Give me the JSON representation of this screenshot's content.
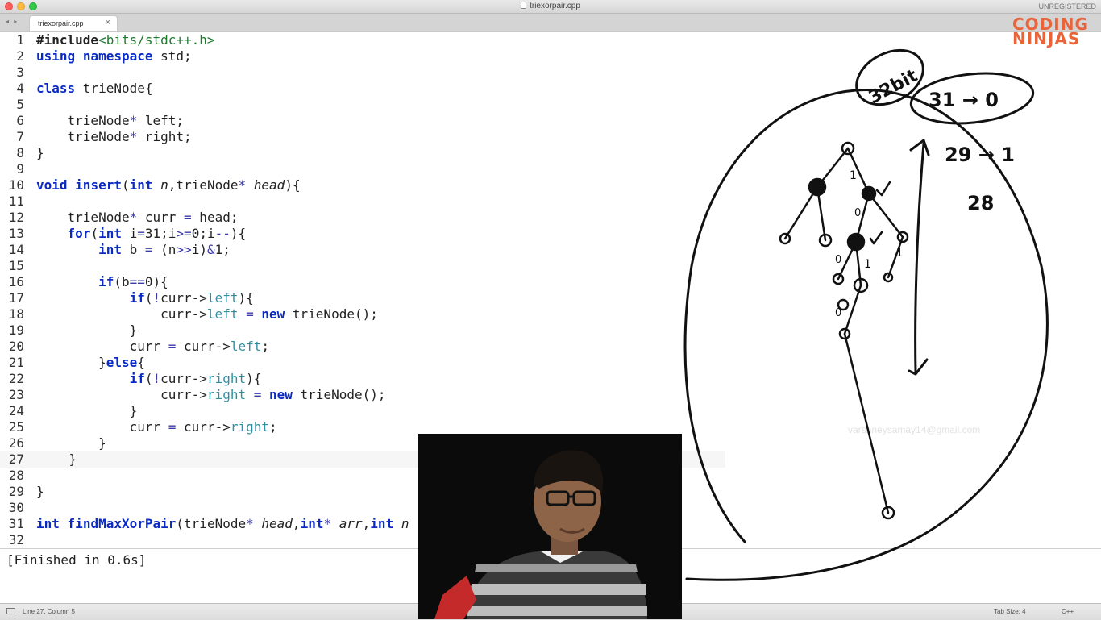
{
  "window": {
    "title": "triexorpair.cpp",
    "unregistered": "UNREGISTERED",
    "tab_nav": "◂ ▸",
    "tab": {
      "label": "triexorpair.cpp",
      "close": "×"
    }
  },
  "editor": {
    "lines": [
      {
        "n": "1"
      },
      {
        "n": "2"
      },
      {
        "n": "3"
      },
      {
        "n": "4"
      },
      {
        "n": "5"
      },
      {
        "n": "6"
      },
      {
        "n": "7"
      },
      {
        "n": "8"
      },
      {
        "n": "9"
      },
      {
        "n": "10"
      },
      {
        "n": "11"
      },
      {
        "n": "12"
      },
      {
        "n": "13"
      },
      {
        "n": "14"
      },
      {
        "n": "15"
      },
      {
        "n": "16"
      },
      {
        "n": "17"
      },
      {
        "n": "18"
      },
      {
        "n": "19"
      },
      {
        "n": "20"
      },
      {
        "n": "21"
      },
      {
        "n": "22"
      },
      {
        "n": "23"
      },
      {
        "n": "24"
      },
      {
        "n": "25"
      },
      {
        "n": "26"
      },
      {
        "n": "27"
      },
      {
        "n": "28"
      },
      {
        "n": "29"
      },
      {
        "n": "30"
      },
      {
        "n": "31"
      },
      {
        "n": "32"
      }
    ],
    "tokens": {
      "l1_pre": "#include",
      "l1_inc": "<bits/stdc++.h>",
      "l2_kw1": "using",
      "l2_kw2": "namespace",
      "l2_rest": " std;",
      "l4_kw": "class",
      "l4_rest": " trieNode{",
      "l6_a": "    trieNode",
      "l6_star": "*",
      "l6_b": " left;",
      "l7_a": "    trieNode",
      "l7_star": "*",
      "l7_b": " right;",
      "l8": "}",
      "l10_void": "void",
      "l10_fn": "insert",
      "l10_a": "(",
      "l10_int": "int",
      "l10_n": "n",
      "l10_b": ",trieNode",
      "l10_star": "*",
      "l10_head": "head",
      "l10_c": "){",
      "l12_a": "    trieNode",
      "l12_star": "*",
      "l12_b": " curr ",
      "l12_eq": "=",
      "l12_c": " head;",
      "l13_for": "for",
      "l13_a": "(",
      "l13_int": "int",
      "l13_b": " i",
      "l13_eq": "=",
      "l13_c": "31;i",
      "l13_ge": ">=",
      "l13_d": "0;i",
      "l13_dec": "--",
      "l13_e": "){",
      "l14_int": "int",
      "l14_a": " b ",
      "l14_eq": "=",
      "l14_b": " (n",
      "l14_sh": ">>",
      "l14_c": "i)",
      "l14_and": "&",
      "l14_d": "1;",
      "l16_if": "if",
      "l16_a": "(b",
      "l16_eq": "==",
      "l16_b": "0){",
      "l17_if": "if",
      "l17_a": "(",
      "l17_not": "!",
      "l17_b": "curr->",
      "l17_mem": "left",
      "l17_c": "){",
      "l18_a": "curr->",
      "l18_mem": "left",
      "l18_eq": " = ",
      "l18_new": "new",
      "l18_b": " trieNode();",
      "l19": "}",
      "l20_a": "curr ",
      "l20_eq": "=",
      "l20_b": " curr->",
      "l20_mem": "left",
      "l20_c": ";",
      "l21_a": "}",
      "l21_else": "else",
      "l21_b": "{",
      "l22_if": "if",
      "l22_a": "(",
      "l22_not": "!",
      "l22_b": "curr->",
      "l22_mem": "right",
      "l22_c": "){",
      "l23_a": "curr->",
      "l23_mem": "right",
      "l23_eq": " = ",
      "l23_new": "new",
      "l23_b": " trieNode();",
      "l24": "}",
      "l25_a": "curr ",
      "l25_eq": "=",
      "l25_b": " curr->",
      "l25_mem": "right",
      "l25_c": ";",
      "l26": "}",
      "l27": "}",
      "l29": "}",
      "l31_int": "int",
      "l31_fn": "findMaxXorPair",
      "l31_a": "(trieNode",
      "l31_star": "*",
      "l31_head": "head",
      "l31_b": ",",
      "l31_int2": "int",
      "l31_star2": "*",
      "l31_arr": "arr",
      "l31_c": ",",
      "l31_int3": "int",
      "l31_n": "n"
    }
  },
  "output": {
    "text": "[Finished in 0.6s]"
  },
  "status": {
    "position": "Line 27, Column 5",
    "tab_size": "Tab Size: 4",
    "language": "C++"
  },
  "sketch": {
    "label_bits": "32bit",
    "label_31": "31 → 0",
    "label_29": "29 → 1",
    "label_28": "28",
    "node_marks": [
      "1",
      "1",
      "0",
      "0",
      "1",
      "0"
    ]
  },
  "logo": {
    "line1": "CODING",
    "line2": "NINJAS"
  },
  "watermark": "varshneysamay14@gmail.com"
}
